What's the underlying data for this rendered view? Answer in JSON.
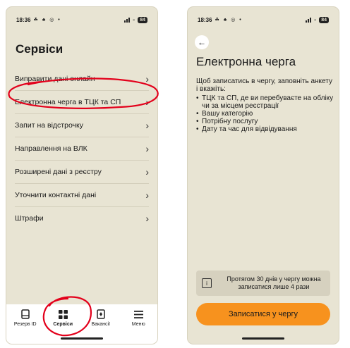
{
  "status_bar": {
    "time": "18:36",
    "icons": "☘ ♣ ◎ •",
    "battery": "84"
  },
  "left_screen": {
    "title": "Сервіси",
    "items": [
      {
        "label": "Виправити дані онлайн"
      },
      {
        "label": "Електронна черга в ТЦК та СП"
      },
      {
        "label": "Запит на відстрочку"
      },
      {
        "label": "Направлення на ВЛК"
      },
      {
        "label": "Розширені дані з реєстру"
      },
      {
        "label": "Уточнити контактні дані"
      },
      {
        "label": "Штрафи"
      }
    ],
    "tabs": [
      {
        "label": "Резерв ID",
        "icon": "document-icon"
      },
      {
        "label": "Сервіси",
        "icon": "grid-icon",
        "active": true
      },
      {
        "label": "Вакансії",
        "icon": "vacancy-icon"
      },
      {
        "label": "Меню",
        "icon": "menu-icon"
      }
    ]
  },
  "right_screen": {
    "title": "Електронна черга",
    "intro": "Щоб записатись в чергу, заповніть анкету і вкажіть:",
    "list": [
      "ТЦК та СП, де ви перебуваєте на обліку чи за місцем реєстрації",
      "Вашу категорію",
      "Потрібну послугу",
      "Дату та час для відвідування"
    ],
    "notice": "Протягом 30 днів у чергу можна записатися лише 4 рази",
    "button": "Записатися у чергу"
  },
  "colors": {
    "background": "#e8e4d3",
    "accent": "#f7921e",
    "annotation": "#e3001b"
  }
}
